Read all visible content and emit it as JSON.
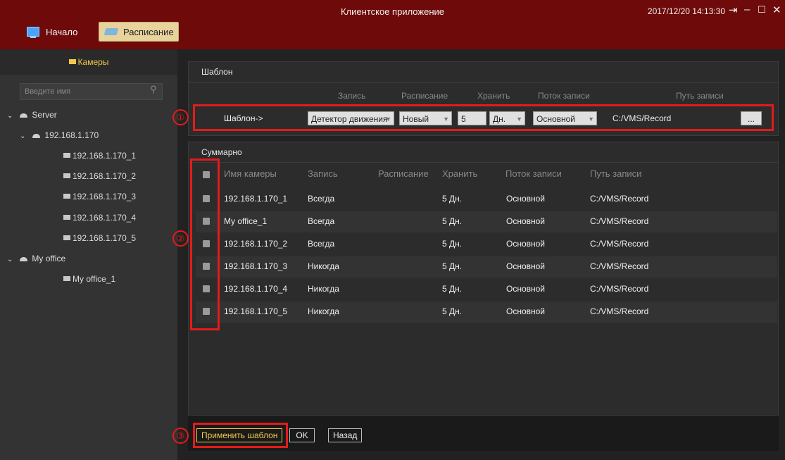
{
  "window": {
    "title": "Клиентское приложение",
    "datetime": "2017/12/20 14:13:30"
  },
  "tabs": {
    "home": "Начало",
    "schedule": "Расписание"
  },
  "sidebar": {
    "title": "Камеры",
    "search_placeholder": "Введите имя",
    "tree": {
      "server": "Server",
      "ip": "192.168.1.170",
      "cams": [
        "192.168.1.170_1",
        "192.168.1.170_2",
        "192.168.1.170_3",
        "192.168.1.170_4",
        "192.168.1.170_5"
      ],
      "office": "My office",
      "office_cam": "My office_1"
    }
  },
  "template": {
    "title": "Шаблон",
    "headers": {
      "record": "Запись",
      "schedule": "Расписание",
      "keep": "Хранить",
      "stream": "Поток записи",
      "path": "Путь записи"
    },
    "row_label": "Шаблон->",
    "record_value": "Детектор движения",
    "schedule_value": "Новый",
    "keep_value": "5",
    "keep_unit": "Дн.",
    "stream_value": "Основной",
    "path_value": "C:/VMS/Record",
    "browse": "..."
  },
  "summary": {
    "title": "Суммарно",
    "headers": {
      "name": "Имя камеры",
      "record": "Запись",
      "schedule": "Расписание",
      "keep": "Хранить",
      "stream": "Поток записи",
      "path": "Путь записи"
    },
    "rows": [
      {
        "name": "192.168.1.170_1",
        "record": "Всегда",
        "keep": "5 Дн.",
        "stream": "Основной",
        "path": "C:/VMS/Record"
      },
      {
        "name": "My office_1",
        "record": "Всегда",
        "keep": "5 Дн.",
        "stream": "Основной",
        "path": "C:/VMS/Record"
      },
      {
        "name": "192.168.1.170_2",
        "record": "Всегда",
        "keep": "5 Дн.",
        "stream": "Основной",
        "path": "C:/VMS/Record"
      },
      {
        "name": "192.168.1.170_3",
        "record": "Никогда",
        "keep": "5 Дн.",
        "stream": "Основной",
        "path": "C:/VMS/Record"
      },
      {
        "name": "192.168.1.170_4",
        "record": "Никогда",
        "keep": "5 Дн.",
        "stream": "Основной",
        "path": "C:/VMS/Record"
      },
      {
        "name": "192.168.1.170_5",
        "record": "Никогда",
        "keep": "5 Дн.",
        "stream": "Основной",
        "path": "C:/VMS/Record"
      }
    ]
  },
  "buttons": {
    "apply": "Применить шаблон",
    "ok": "OK",
    "back": "Назад"
  },
  "markers": [
    "①",
    "②",
    "③"
  ]
}
